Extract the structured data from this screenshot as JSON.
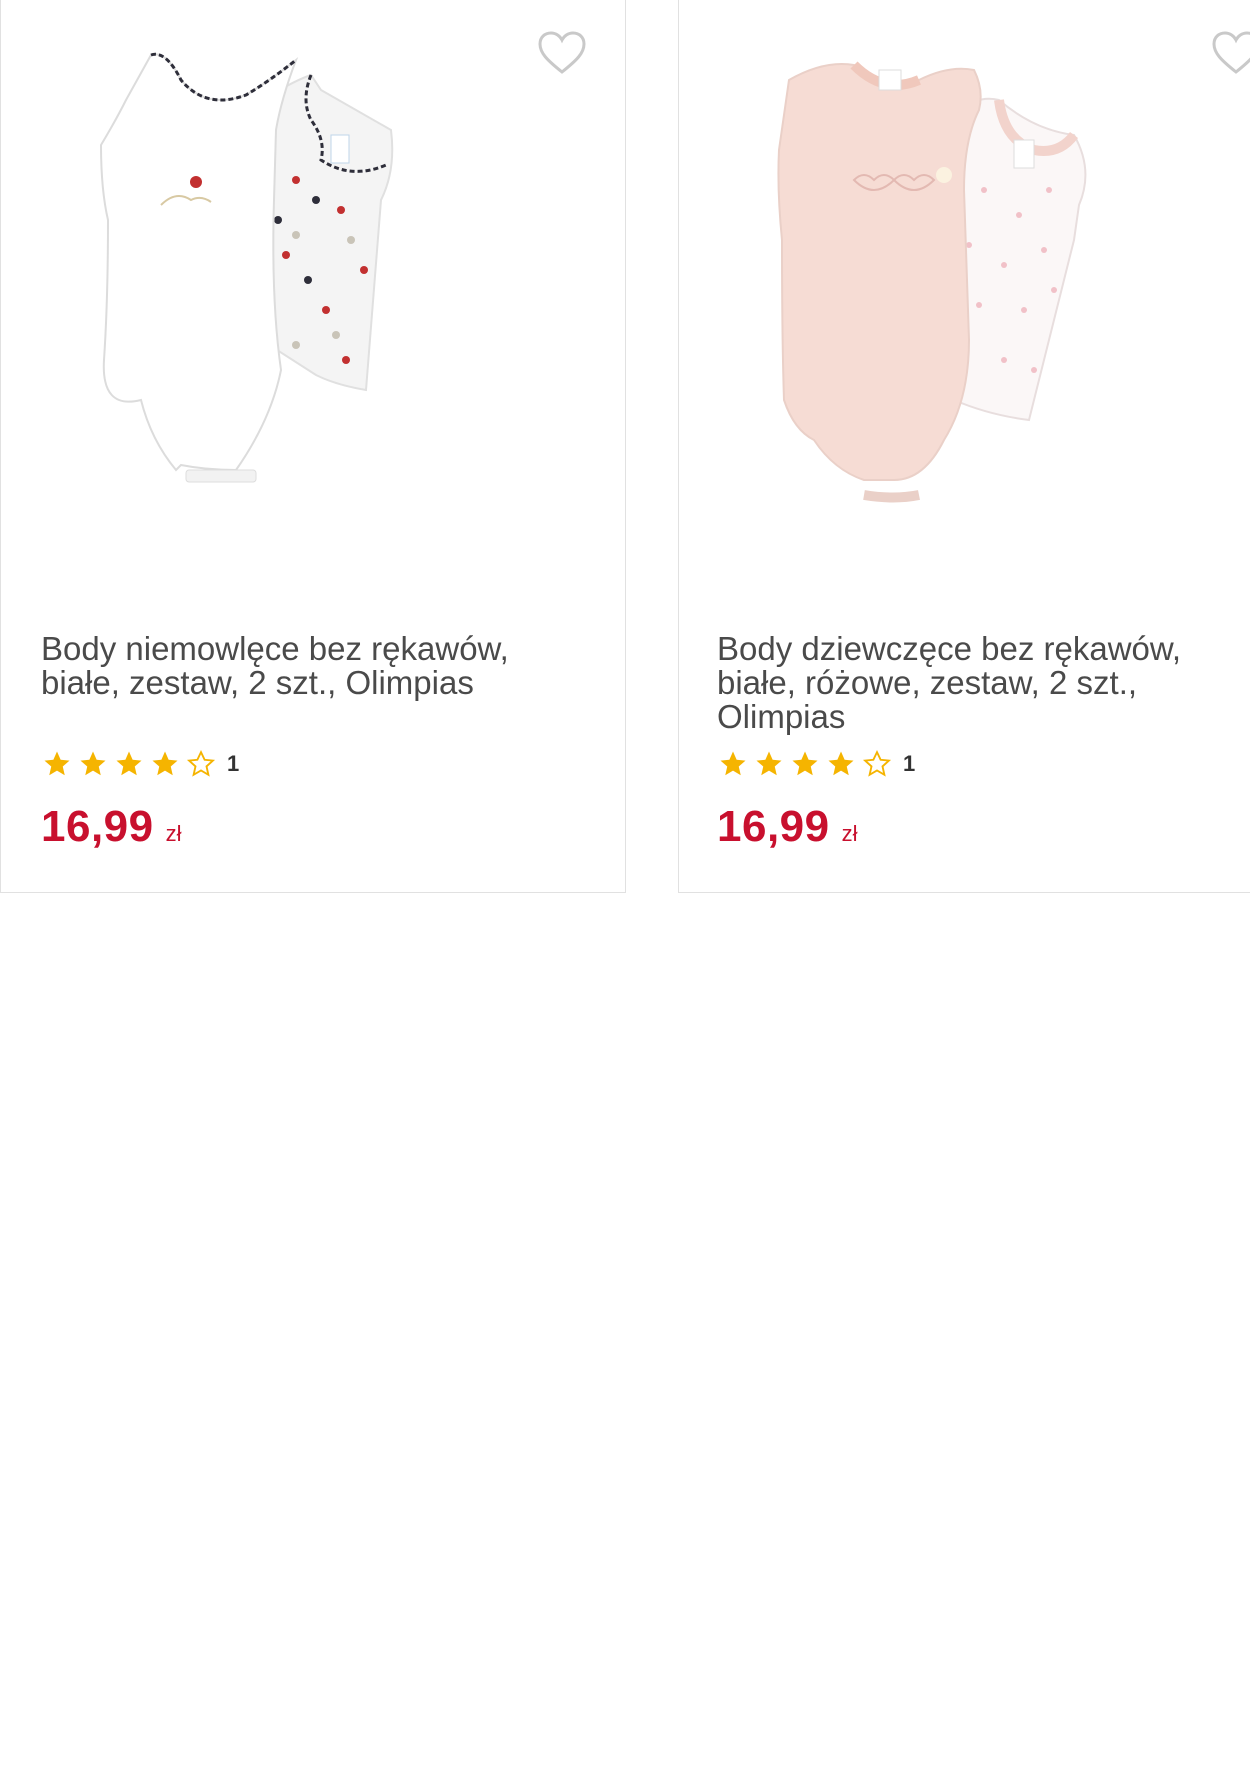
{
  "colors": {
    "price": "#c8102e",
    "star_filled": "#f5b400",
    "star_empty_stroke": "#f5b400",
    "title": "#4a4a4a",
    "card_border": "#e1e1e1",
    "heart_stroke": "#c9c9c9"
  },
  "products": [
    {
      "title": "Body niemowlęce bez rękawów, białe, zestaw, 2 szt., Olimpias",
      "rating": 4,
      "rating_max": 5,
      "review_count": "1",
      "price": "16,99",
      "currency": "zł",
      "favorite_icon": "heart-outline-icon",
      "image_icon": "baby-bodysuit-white-set-image"
    },
    {
      "title": "Body dziewczęce bez rękawów, białe, różowe, zestaw, 2 szt., Olimpias",
      "rating": 4,
      "rating_max": 5,
      "review_count": "1",
      "price": "16,99",
      "currency": "zł",
      "favorite_icon": "heart-outline-icon",
      "image_icon": "baby-bodysuit-pink-set-image"
    }
  ]
}
